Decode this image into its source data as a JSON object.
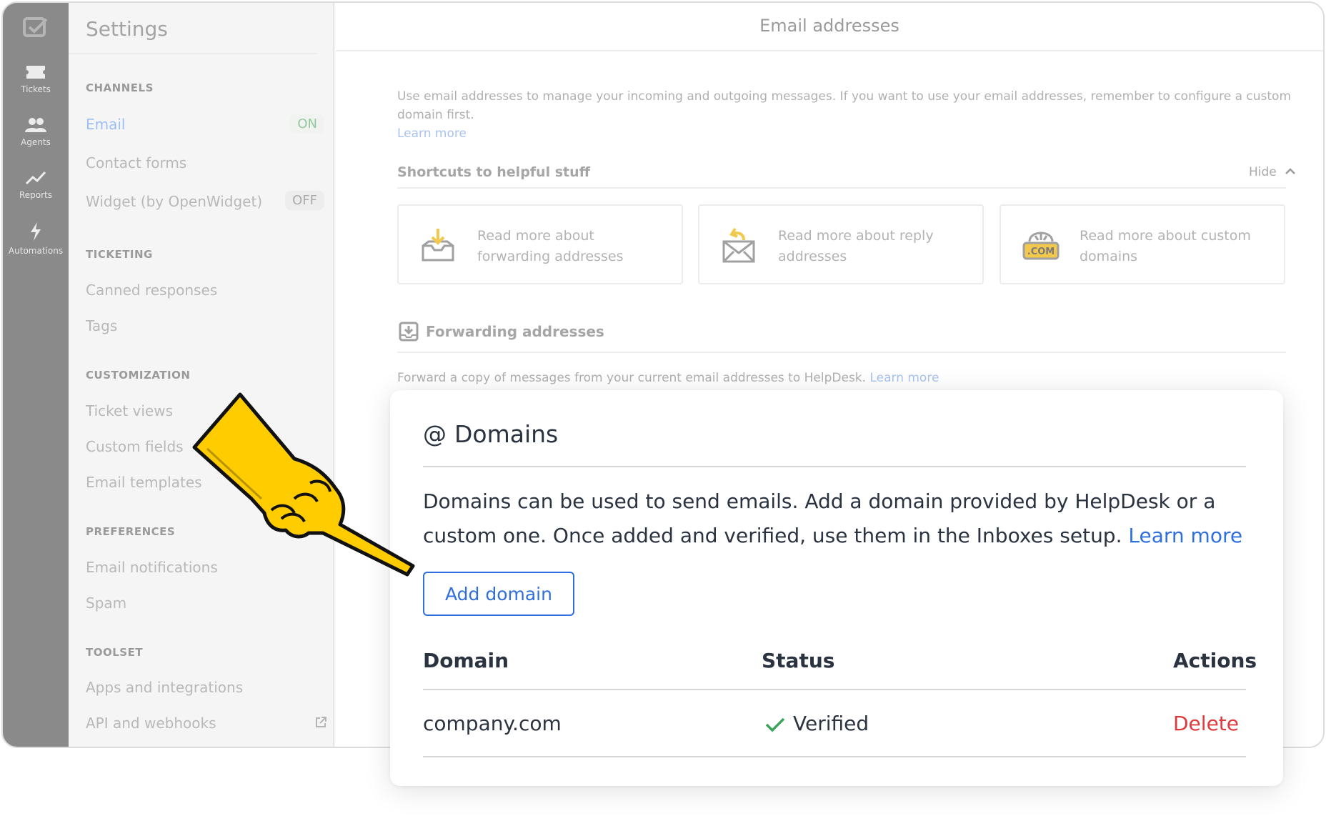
{
  "rail": {
    "items": [
      {
        "label": "Tickets",
        "icon": "ticket-icon"
      },
      {
        "label": "Agents",
        "icon": "agents-icon"
      },
      {
        "label": "Reports",
        "icon": "reports-icon"
      },
      {
        "label": "Automations",
        "icon": "lightning-icon"
      }
    ]
  },
  "sidebar": {
    "title": "Settings",
    "sections": {
      "channels": "CHANNELS",
      "ticketing": "TICKETING",
      "customization": "CUSTOMIZATION",
      "preferences": "PREFERENCES",
      "toolset": "TOOLSET"
    },
    "items": {
      "email": "Email",
      "email_status": "ON",
      "contact_forms": "Contact forms",
      "widget": "Widget (by OpenWidget)",
      "widget_status": "OFF",
      "canned": "Canned responses",
      "tags": "Tags",
      "ticket_views": "Ticket views",
      "custom_fields": "Custom fields",
      "email_templates": "Email templates",
      "email_notifications": "Email notifications",
      "spam": "Spam",
      "apps": "Apps and integrations",
      "api": "API and webhooks"
    }
  },
  "main": {
    "title": "Email addresses",
    "description": "Use email addresses to manage your incoming and outgoing messages. If you want to use your email addresses, remember to configure a custom domain first.",
    "learn_more": "Learn more",
    "shortcuts_title": "Shortcuts to helpful stuff",
    "hide_label": "Hide",
    "cards": [
      "Read more about forwarding addresses",
      "Read more about reply addresses",
      "Read more about custom domains"
    ],
    "com_label": ".COM",
    "forwarding_title": "Forwarding addresses",
    "forwarding_desc": "Forward a copy of messages from your current email addresses to HelpDesk.",
    "forwarding_learn_more": "Learn more"
  },
  "domains": {
    "at_symbol": "@",
    "title": "Domains",
    "description": "Domains can be used to send emails. Add a domain provided by HelpDesk or a custom one. Once added and verified, use them in the Inboxes setup.",
    "learn_more": "Learn more",
    "add_button": "Add domain",
    "headers": {
      "domain": "Domain",
      "status": "Status",
      "actions": "Actions"
    },
    "rows": [
      {
        "domain": "company.com",
        "status": "Verified",
        "action": "Delete"
      }
    ]
  },
  "colors": {
    "accent": "#2f6fde",
    "danger": "#e0393e",
    "success": "#3aa55a",
    "pointer_hand": "#ffcc00"
  }
}
